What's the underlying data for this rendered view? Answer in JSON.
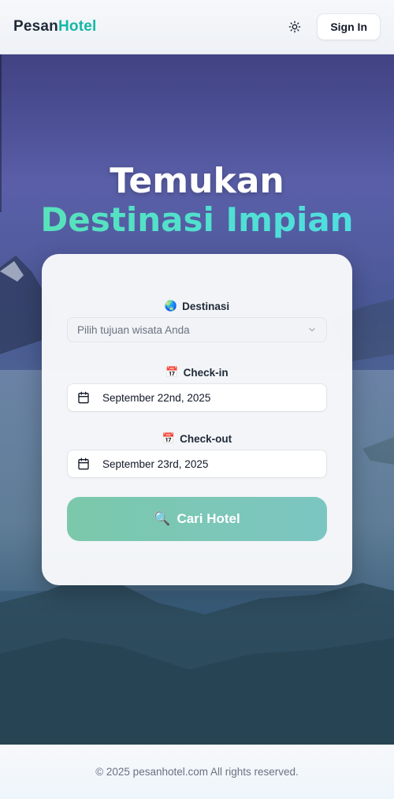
{
  "header": {
    "logo_part1": "Pesan",
    "logo_part2": "Hotel",
    "theme_icon": "sun-icon",
    "signin_label": "Sign In"
  },
  "hero": {
    "title_line1": "Temukan",
    "title_line2": "Destinasi Impian"
  },
  "form": {
    "destination": {
      "emoji": "🌏",
      "label": "Destinasi",
      "placeholder": "Pilih tujuan wisata Anda",
      "icon": "chevron-down-icon"
    },
    "checkin": {
      "emoji": "📅",
      "label": "Check-in",
      "value": "September 22nd, 2025",
      "icon": "calendar-icon"
    },
    "checkout": {
      "emoji": "📅",
      "label": "Check-out",
      "value": "September 23rd, 2025",
      "icon": "calendar-icon"
    },
    "search": {
      "emoji": "🔍",
      "label": "Cari Hotel"
    }
  },
  "footer": {
    "copyright": "© 2025 pesanhotel.com All rights reserved."
  },
  "colors": {
    "brand_accent": "#14b8a6",
    "button_gradient_start": "#7bc8ab",
    "button_gradient_end": "#7cc6c2"
  }
}
